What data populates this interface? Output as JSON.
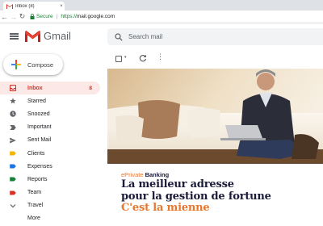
{
  "browser": {
    "tab_title": "Inbox (8)",
    "tab_close": "×",
    "security_label": "Secure",
    "url_scheme": "https://",
    "url_host": "mail.google.com"
  },
  "header": {
    "app_name": "Gmail",
    "search_placeholder": "Search mail"
  },
  "sidebar": {
    "compose_label": "Compose",
    "items": [
      {
        "label": "Inbox",
        "count": "8",
        "icon": "inbox-icon",
        "color": "#d93025"
      },
      {
        "label": "Starred",
        "count": "",
        "icon": "star-icon",
        "color": "#5f6368"
      },
      {
        "label": "Snoozed",
        "count": "",
        "icon": "clock-icon",
        "color": "#5f6368"
      },
      {
        "label": "Important",
        "count": "",
        "icon": "important-icon",
        "color": "#5f6368"
      },
      {
        "label": "Sent Mail",
        "count": "",
        "icon": "send-icon",
        "color": "#5f6368"
      },
      {
        "label": "Clients",
        "count": "",
        "icon": "label-icon",
        "color": "#f4b400"
      },
      {
        "label": "Expenses",
        "count": "",
        "icon": "label-icon",
        "color": "#1a73e8"
      },
      {
        "label": "Reports",
        "count": "",
        "icon": "label-icon",
        "color": "#188038"
      },
      {
        "label": "Team",
        "count": "",
        "icon": "label-icon",
        "color": "#d93025"
      },
      {
        "label": "Travel",
        "count": "",
        "icon": "chevron-down-icon",
        "color": "#5f6368"
      },
      {
        "label": "More",
        "count": "",
        "icon": "",
        "color": "#5f6368"
      }
    ]
  },
  "toolbar": {
    "caret": "▾",
    "more": "⋮"
  },
  "ad": {
    "brand_prefix": "ePrivate",
    "brand_suffix": " Banking",
    "headline_1": "La meilleur adresse",
    "headline_2": "pour la gestion de fortune",
    "headline_3": "C'est la mienne"
  },
  "colors": {
    "accent_red": "#d93025",
    "brand_orange": "#e8772e",
    "brand_navy": "#1b1b3a"
  }
}
